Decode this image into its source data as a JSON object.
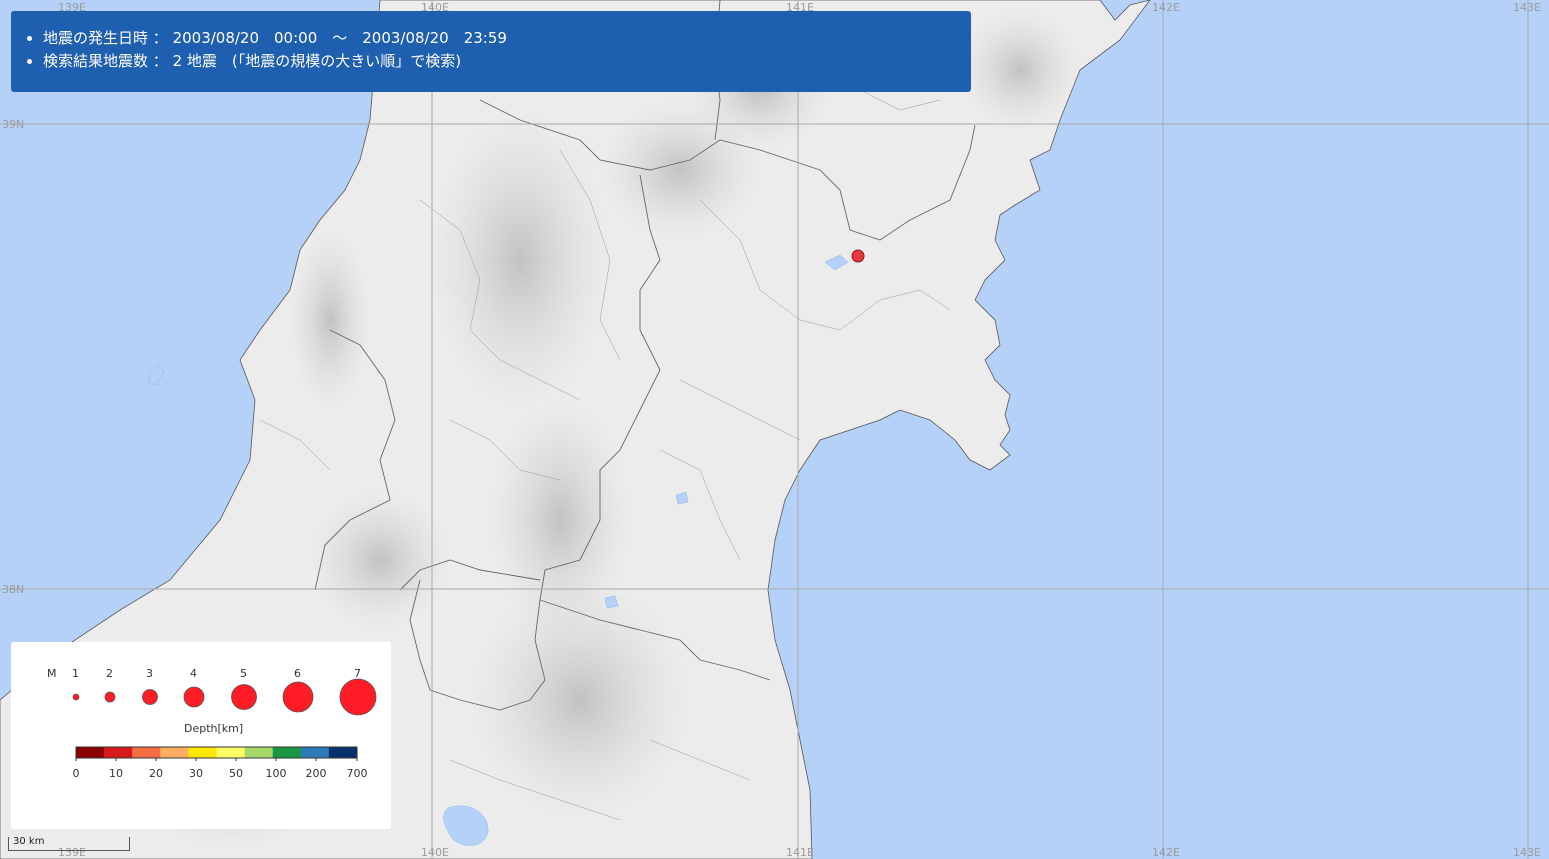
{
  "info": {
    "line1_label": "地震の発生日時",
    "line1_value": "2003/08/20　00:00　～　2003/08/20　23:59",
    "line2_label": "検索結果地震数",
    "line2_value": "2 地震　(「地震の規模の大きい順」で検索)"
  },
  "grid_labels": {
    "lon": [
      "139E",
      "140E",
      "141E",
      "142E",
      "143E"
    ],
    "lat": [
      "39N",
      "38N"
    ]
  },
  "legend": {
    "magnitude_label": "M",
    "magnitudes": [
      "1",
      "2",
      "3",
      "4",
      "5",
      "6",
      "7"
    ],
    "depth_title": "Depth[km]",
    "depth_ticks": [
      "0",
      "10",
      "20",
      "30",
      "50",
      "100",
      "200",
      "700"
    ],
    "depth_colors": [
      "#8b0000",
      "#d7191c",
      "#f46d43",
      "#fdae61",
      "#fee700",
      "#ffff66",
      "#a6d96a",
      "#1a9641",
      "#2c7bb6",
      "#08306b"
    ]
  },
  "scale_bar": {
    "label": "30 km"
  },
  "epicenters": [
    {
      "magnitude": 2.4,
      "color": "#e53840"
    }
  ],
  "colors": {
    "sea": "#b6d1f8",
    "land": "#ececec",
    "header_bg": "#1f5fb0",
    "marker": "#ff1c26"
  }
}
